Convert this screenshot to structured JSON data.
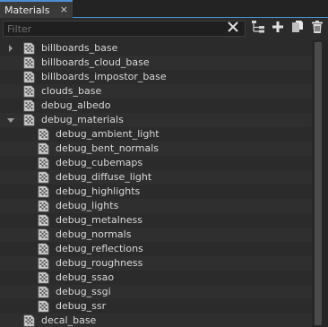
{
  "tab": {
    "label": "Materials",
    "close": "×"
  },
  "filter": {
    "placeholder": "Filter",
    "value": ""
  },
  "toolbar": {
    "icons": [
      "close-icon",
      "hierarchy-icon",
      "add-icon",
      "clone-icon",
      "trash-icon"
    ]
  },
  "tree": {
    "items": [
      {
        "label": "billboards_base",
        "level": 0,
        "expander": "collapsed"
      },
      {
        "label": "billboards_cloud_base",
        "level": 0,
        "expander": "none"
      },
      {
        "label": "billboards_impostor_base",
        "level": 0,
        "expander": "none"
      },
      {
        "label": "clouds_base",
        "level": 0,
        "expander": "none"
      },
      {
        "label": "debug_albedo",
        "level": 0,
        "expander": "none"
      },
      {
        "label": "debug_materials",
        "level": 0,
        "expander": "expanded"
      },
      {
        "label": "debug_ambient_light",
        "level": 1,
        "expander": "none"
      },
      {
        "label": "debug_bent_normals",
        "level": 1,
        "expander": "none"
      },
      {
        "label": "debug_cubemaps",
        "level": 1,
        "expander": "none"
      },
      {
        "label": "debug_diffuse_light",
        "level": 1,
        "expander": "none"
      },
      {
        "label": "debug_highlights",
        "level": 1,
        "expander": "none"
      },
      {
        "label": "debug_lights",
        "level": 1,
        "expander": "none"
      },
      {
        "label": "debug_metalness",
        "level": 1,
        "expander": "none"
      },
      {
        "label": "debug_normals",
        "level": 1,
        "expander": "none"
      },
      {
        "label": "debug_reflections",
        "level": 1,
        "expander": "none"
      },
      {
        "label": "debug_roughness",
        "level": 1,
        "expander": "none"
      },
      {
        "label": "debug_ssao",
        "level": 1,
        "expander": "none"
      },
      {
        "label": "debug_ssgi",
        "level": 1,
        "expander": "none"
      },
      {
        "label": "debug_ssr",
        "level": 1,
        "expander": "none"
      },
      {
        "label": "decal_base",
        "level": 0,
        "expander": "none"
      }
    ]
  },
  "colors": {
    "accent": "#4a8fd0",
    "background": "#2b2b2b"
  }
}
